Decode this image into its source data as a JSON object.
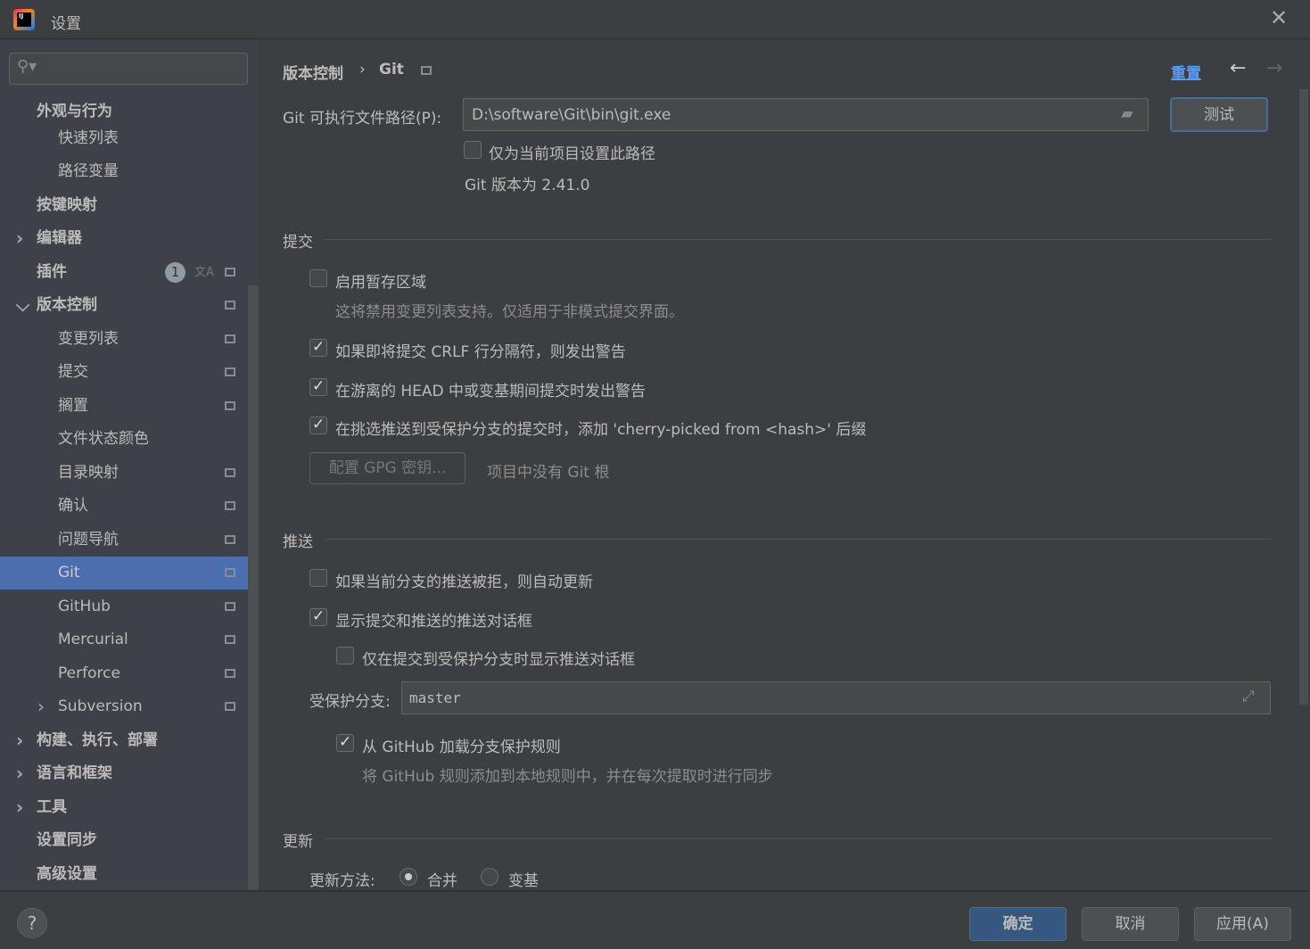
{
  "window": {
    "title": "设置"
  },
  "sidebar": {
    "items": [
      {
        "label": "外观与行为",
        "bold": true
      },
      {
        "label": "快速列表"
      },
      {
        "label": "路径变量"
      },
      {
        "label": "按键映射",
        "bold": true
      },
      {
        "label": "编辑器",
        "bold": true
      },
      {
        "label": "插件",
        "bold": true,
        "badge": "1"
      },
      {
        "label": "版本控制",
        "bold": true
      },
      {
        "label": "变更列表"
      },
      {
        "label": "提交"
      },
      {
        "label": "搁置"
      },
      {
        "label": "文件状态颜色"
      },
      {
        "label": "目录映射"
      },
      {
        "label": "确认"
      },
      {
        "label": "问题导航"
      },
      {
        "label": "Git",
        "selected": true
      },
      {
        "label": "GitHub"
      },
      {
        "label": "Mercurial"
      },
      {
        "label": "Perforce"
      },
      {
        "label": "Subversion"
      },
      {
        "label": "构建、执行、部署",
        "bold": true
      },
      {
        "label": "语言和框架",
        "bold": true
      },
      {
        "label": "工具",
        "bold": true
      },
      {
        "label": "设置同步",
        "bold": true
      },
      {
        "label": "高级设置",
        "bold": true
      }
    ]
  },
  "header": {
    "breadcrumb_parent": "版本控制",
    "breadcrumb_sep": "›",
    "breadcrumb_current": "Git",
    "reset": "重置"
  },
  "git": {
    "path_label": "Git 可执行文件路径(P):",
    "path_value": "D:\\software\\Git\\bin\\git.exe",
    "test": "测试",
    "project_only": "仅为当前项目设置此路径",
    "version": "Git 版本为 2.41.0"
  },
  "commit": {
    "title": "提交",
    "staging": "启用暂存区域",
    "staging_hint": "这将禁用变更列表支持。仅适用于非模式提交界面。",
    "crlf": "如果即将提交 CRLF 行分隔符，则发出警告",
    "detached": "在游离的 HEAD 中或变基期间提交时发出警告",
    "cherry": "在挑选推送到受保护分支的提交时，添加 'cherry-picked from <hash>' 后缀",
    "gpg": "配置 GPG 密钥...",
    "no_root": "项目中没有 Git 根"
  },
  "push": {
    "title": "推送",
    "auto_update": "如果当前分支的推送被拒，则自动更新",
    "show_dialog": "显示提交和推送的推送对话框",
    "protected_only": "仅在提交到受保护分支时显示推送对话框",
    "protected_label": "受保护分支:",
    "protected_value": "master",
    "load_github": "从 GitHub 加载分支保护规则",
    "load_github_hint": "将 GitHub 规则添加到本地规则中，并在每次提取时进行同步"
  },
  "update": {
    "title": "更新",
    "method_label": "更新方法:",
    "merge": "合并",
    "rebase": "变基"
  },
  "footer": {
    "help": "?",
    "ok": "确定",
    "cancel": "取消",
    "apply": "应用(A)"
  },
  "colors": {
    "accent": "#4b6eaf",
    "link": "#589df6"
  }
}
